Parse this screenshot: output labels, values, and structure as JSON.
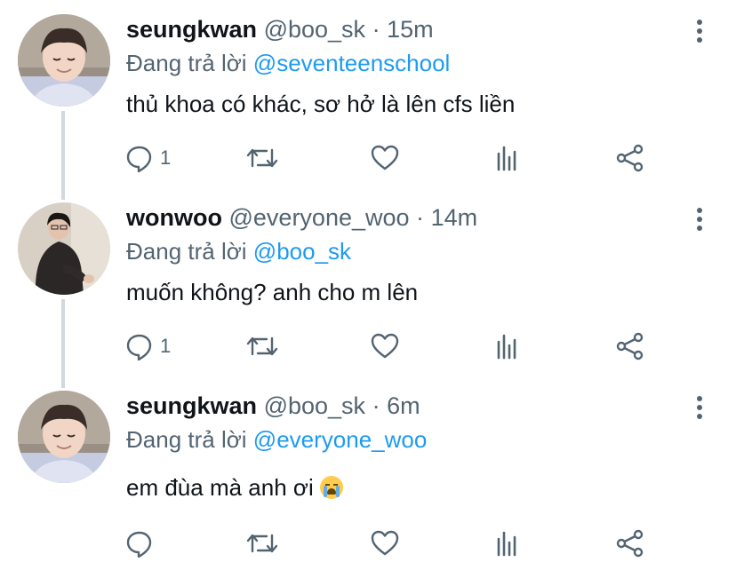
{
  "tweets": [
    {
      "name": "seungkwan",
      "handle": "@boo_sk",
      "time": "15m",
      "reply_prefix": "Đang trả lời",
      "mention": "@seventeenschool",
      "text": "thủ khoa có khác, sơ hở là lên cfs liền",
      "reply_count": "1",
      "avatar": "seungkwan-avatar"
    },
    {
      "name": "wonwoo",
      "handle": "@everyone_woo",
      "time": "14m",
      "reply_prefix": "Đang trả lời",
      "mention": "@boo_sk",
      "text": "muốn không? anh cho m lên",
      "reply_count": "1",
      "avatar": "wonwoo-avatar"
    },
    {
      "name": "seungkwan",
      "handle": "@boo_sk",
      "time": "6m",
      "reply_prefix": "Đang trả lời",
      "mention": "@everyone_woo",
      "text": "em đùa mà anh ơi",
      "emoji": "loudly-crying-face",
      "reply_count": "",
      "avatar": "seungkwan-avatar"
    }
  ],
  "separator": "·",
  "colors": {
    "mention": "#1d9bf0",
    "secondary": "#536471",
    "thread_line": "#cfd9de"
  }
}
